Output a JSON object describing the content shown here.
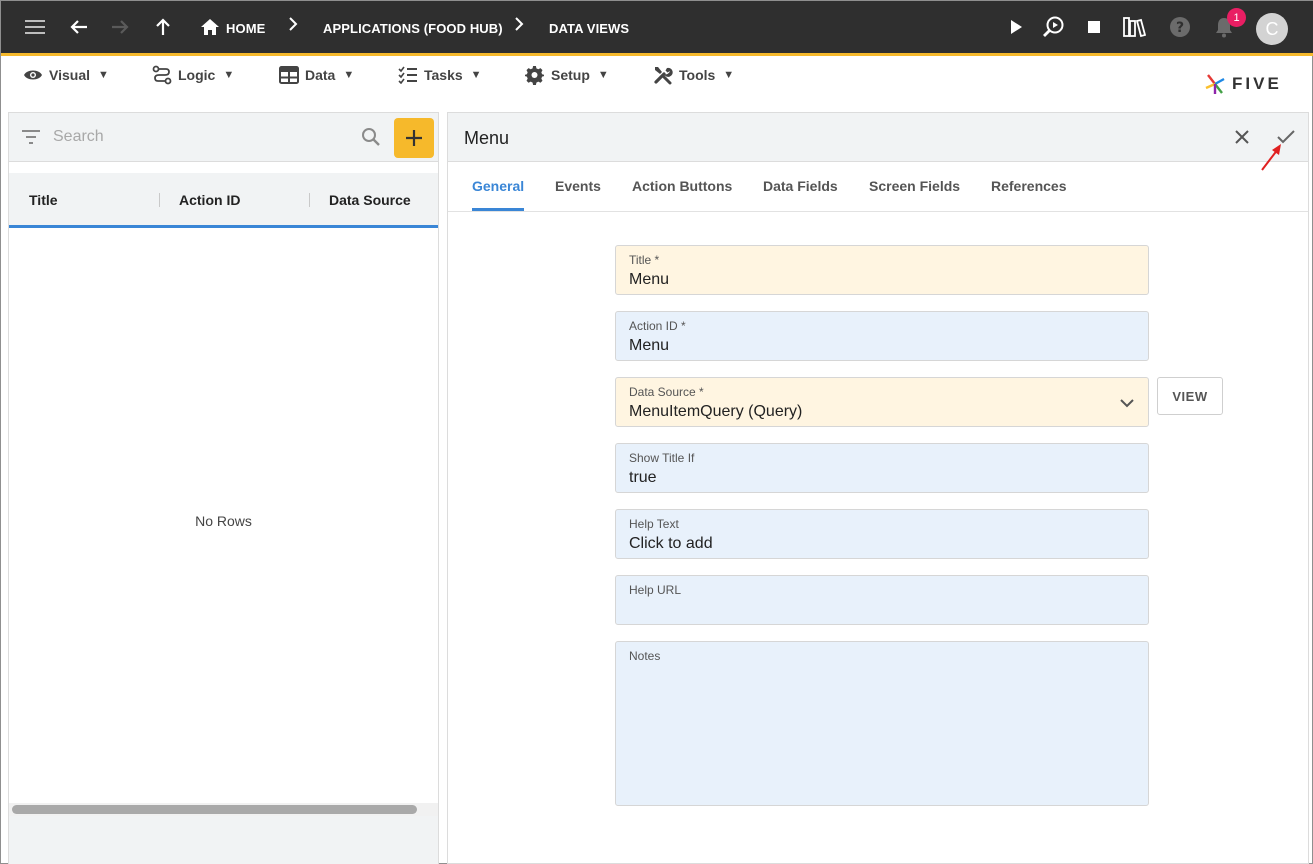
{
  "appbar": {
    "breadcrumbs": [
      "HOME",
      "APPLICATIONS (FOOD HUB)",
      "DATA VIEWS"
    ],
    "notification_count": "1",
    "avatar_initial": "C",
    "icons": [
      "menu-icon",
      "back-arrow-icon",
      "forward-arrow-icon",
      "up-arrow-icon",
      "home-icon",
      "play-icon",
      "search-inspect-icon",
      "stop-icon",
      "library-icon",
      "help-icon",
      "bell-icon"
    ]
  },
  "menubar": {
    "items": [
      {
        "label": "Visual",
        "icon": "eye-icon"
      },
      {
        "label": "Logic",
        "icon": "logic-flow-icon"
      },
      {
        "label": "Data",
        "icon": "table-icon"
      },
      {
        "label": "Tasks",
        "icon": "checklist-icon"
      },
      {
        "label": "Setup",
        "icon": "gear-icon"
      },
      {
        "label": "Tools",
        "icon": "tools-icon"
      }
    ],
    "caret": "▼",
    "logo_text": "FIVE"
  },
  "left_panel": {
    "search_placeholder": "Search",
    "columns": [
      "Title",
      "Action ID",
      "Data Source"
    ],
    "empty_text": "No Rows"
  },
  "form": {
    "title": "Menu",
    "tabs": [
      "General",
      "Events",
      "Action Buttons",
      "Data Fields",
      "Screen Fields",
      "References"
    ],
    "active_tab": "General",
    "fields": {
      "title": {
        "label": "Title *",
        "value": "Menu"
      },
      "action_id": {
        "label": "Action ID *",
        "value": "Menu"
      },
      "data_source": {
        "label": "Data Source *",
        "value": "MenuItemQuery (Query)"
      },
      "show_title_if": {
        "label": "Show Title If",
        "value": "true"
      },
      "help_text": {
        "label": "Help Text",
        "value": "Click to add"
      },
      "help_url": {
        "label": "Help URL",
        "value": ""
      },
      "notes": {
        "label": "Notes",
        "value": ""
      }
    },
    "view_button": "VIEW"
  },
  "colors": {
    "appbar": "#2f2f2f",
    "accent": "#f6b92b",
    "active_tab": "#3a86d6",
    "required_field": "#fff5e1",
    "optional_field": "#e8f1fb",
    "badge": "#e91e63",
    "pointer_arrow": "#e02020"
  }
}
